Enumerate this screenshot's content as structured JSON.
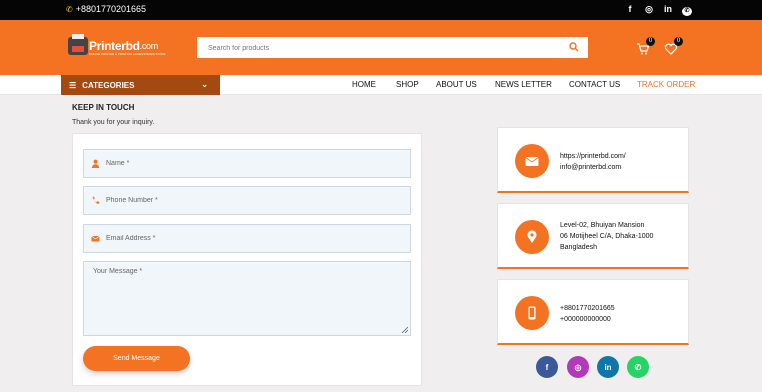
{
  "topbar": {
    "phone": "+8801770201665",
    "social_icons": [
      "facebook-icon",
      "instagram-icon",
      "linkedin-icon",
      "whatsapp-icon"
    ],
    "social_glyphs": {
      "facebook": "f",
      "instagram": "◎",
      "linkedin": "in",
      "whatsapp": "✆"
    }
  },
  "header": {
    "logo_text": "Printerbd",
    "logo_suffix": ".com",
    "logo_tagline": "ONLINE PRINTER & PRINTING ACCESSORIES STORE",
    "search_placeholder": "Search for products",
    "cart_count": "0",
    "wishlist_count": "0"
  },
  "nav": {
    "categories_label": "CATEGORIES",
    "items": [
      {
        "label": "HOME"
      },
      {
        "label": "SHOP"
      },
      {
        "label": "ABOUT US"
      },
      {
        "label": "NEWS LETTER"
      },
      {
        "label": "CONTACT US"
      },
      {
        "label": "TRACK ORDER"
      }
    ]
  },
  "contact": {
    "title": "KEEP IN TOUCH",
    "subtitle": "Thank you for your inquiry.",
    "form": {
      "name_placeholder": "Name *",
      "phone_placeholder": "Phone Number *",
      "email_placeholder": "Email Address *",
      "message_placeholder": "Your Message *",
      "submit_label": "Send Message"
    },
    "info_cards": [
      {
        "icon": "envelope-icon",
        "lines": [
          "https://printerbd.com/",
          "info@printerbd.com"
        ]
      },
      {
        "icon": "location-pin-icon",
        "lines": [
          "Level-02, Bhuiyan Mansion",
          "06 Motijheel C/A, Dhaka-1000",
          "Bangladesh"
        ]
      },
      {
        "icon": "mobile-phone-icon",
        "lines": [
          "+8801770201665",
          "+000000000000"
        ]
      }
    ],
    "social": [
      {
        "name": "facebook-icon",
        "glyph": "f",
        "color": "#3b5998"
      },
      {
        "name": "instagram-icon",
        "glyph": "◎",
        "color": "#b23ab8"
      },
      {
        "name": "linkedin-icon",
        "glyph": "in",
        "color": "#0e76a8"
      },
      {
        "name": "whatsapp-icon",
        "glyph": "✆",
        "color": "#25d366"
      }
    ]
  },
  "colors": {
    "brand_orange": "#f37323",
    "dark_orange": "#a44a11",
    "topbar_bg": "#050505",
    "page_bg": "#f0eeee"
  }
}
